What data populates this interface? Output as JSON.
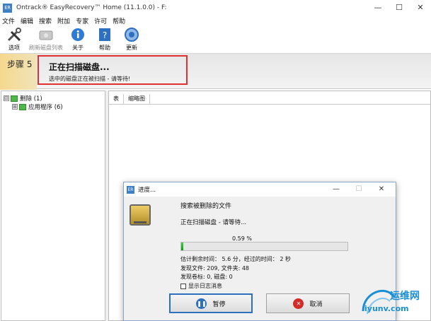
{
  "window": {
    "title": "Ontrack® EasyRecovery™ Home (11.1.0.0) - F:",
    "app_icon_text": "ER",
    "minimize": "—",
    "maximize": "☐",
    "close": "✕"
  },
  "menu": [
    "文件",
    "编辑",
    "搜索",
    "附加",
    "专家",
    "许可",
    "帮助"
  ],
  "toolbar": [
    {
      "label": "选项",
      "icon": "tools-icon",
      "enabled": true
    },
    {
      "label": "刷新磁盘列表",
      "icon": "refresh-disk-icon",
      "enabled": false
    },
    {
      "label": "关于",
      "icon": "info-icon",
      "enabled": true
    },
    {
      "label": "帮助",
      "icon": "help-icon",
      "enabled": true
    },
    {
      "label": "更新",
      "icon": "update-icon",
      "enabled": true
    }
  ],
  "step": {
    "label": "步骤 5",
    "title": "正在扫描磁盘...",
    "subtitle": "选中的磁盘正在被扫描 - 请等待!"
  },
  "tree": {
    "root": {
      "label": "删除 (1)",
      "expander": "⊟"
    },
    "child": {
      "label": "应用程序 (6)",
      "expander": "⊞"
    }
  },
  "tabs": [
    "表",
    "缩略图"
  ],
  "dialog": {
    "title": "进度...",
    "heading": "搜索被删除的文件",
    "status": "正在扫描磁盘 - 请等待...",
    "percent_text": "0.59 %",
    "progress": 0.0059,
    "remaining": "估计剩余时间： 5.6 分，经过的时间： 2 秒",
    "found_files": "发现文件: 209, 文件夹: 48",
    "found_volumes": "发现卷标: 0, 磁盘: 0",
    "show_log": "显示日志消息",
    "pause_label": "暂停",
    "cancel_label": "取消",
    "minimize": "—",
    "maximize": "☐",
    "close": "✕"
  },
  "watermark": {
    "text": "运维网",
    "url": "iyunv.com"
  },
  "colors": {
    "accent": "#3f7fc3",
    "step_band": "#f5d88e",
    "highlight_border": "#e03030",
    "progress_fill": "#0aa012",
    "watermark": "#1a8fd6"
  }
}
